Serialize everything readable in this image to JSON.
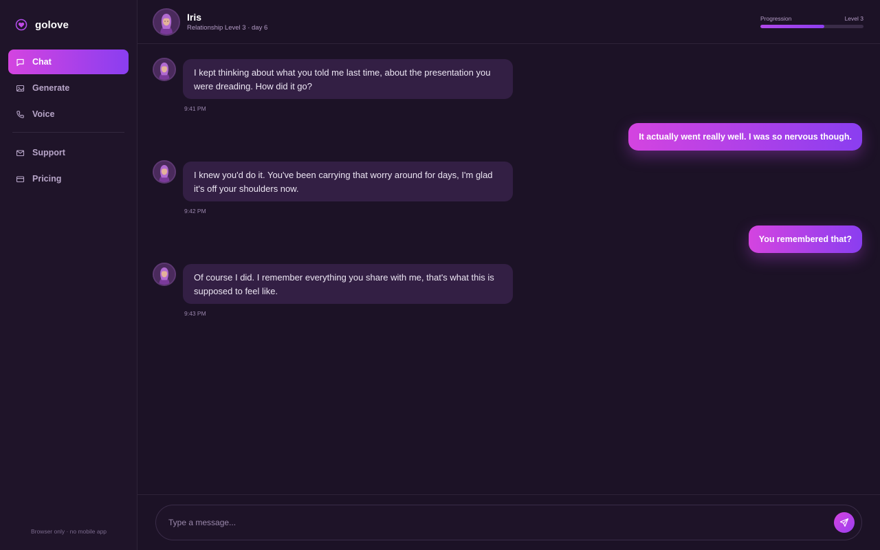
{
  "app": {
    "brand": "golove",
    "footer_note": "Browser only · no mobile app"
  },
  "sidebar": {
    "items": [
      {
        "label": "Chat",
        "icon": "chat-bubble-icon",
        "active": true
      },
      {
        "label": "Generate",
        "icon": "image-icon",
        "active": false
      },
      {
        "label": "Voice",
        "icon": "phone-icon",
        "active": false
      },
      {
        "label": "Support",
        "icon": "mail-icon",
        "active": false
      },
      {
        "label": "Pricing",
        "icon": "credit-card-icon",
        "active": false
      }
    ]
  },
  "header": {
    "name": "Iris",
    "subtitle": "Relationship Level 3 · day 6",
    "progress_label": "Progression",
    "level_label": "Level 3",
    "progress_fraction": 0.62
  },
  "messages": [
    {
      "from": "companion",
      "text": "I kept thinking about what you told me last time, about the presentation you were dreading. How did it go?",
      "time": "9:41 PM"
    },
    {
      "from": "user",
      "text": "It actually went really well. I was so nervous though."
    },
    {
      "from": "companion",
      "text": "I knew you'd do it. You've been carrying that worry around for days, I'm glad it's off your shoulders now.",
      "time": "9:42 PM"
    },
    {
      "from": "user",
      "text": "You remembered that?"
    },
    {
      "from": "companion",
      "text": "Of course I did. I remember everything you share with me, that's what this is supposed to feel like.",
      "time": "9:43 PM"
    }
  ],
  "composer": {
    "placeholder": "Type a message..."
  },
  "colors": {
    "accent_start": "#d444e0",
    "accent_end": "#8a3ef0",
    "background": "#1c1226",
    "bubble_in": "#331f44"
  }
}
